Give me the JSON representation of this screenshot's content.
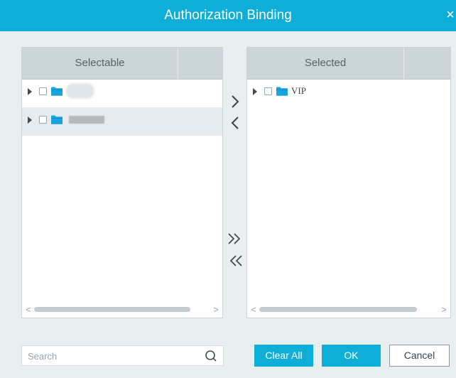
{
  "dialog": {
    "title": "Authorization Binding",
    "close_glyph": "×"
  },
  "selectable": {
    "header": "Selectable",
    "items": [
      {
        "label": "",
        "icon": "folder-icon",
        "expanded": false
      },
      {
        "label": "",
        "icon": "folder-icon",
        "expanded": false
      }
    ],
    "scroll": {
      "left_glyph": "<",
      "right_glyph": ">"
    }
  },
  "selected": {
    "header": "Selected",
    "items": [
      {
        "label": "VIP",
        "icon": "folder-icon",
        "expanded": false
      }
    ],
    "scroll": {
      "left_glyph": "<",
      "right_glyph": ">"
    }
  },
  "transfer": {
    "add_icon": "chevron-right-icon",
    "remove_icon": "chevron-left-icon",
    "add_all_icon": "double-chevron-right-icon",
    "remove_all_icon": "double-chevron-left-icon"
  },
  "search": {
    "placeholder": "Search",
    "value": ""
  },
  "buttons": {
    "clear_all": "Clear All",
    "ok": "OK",
    "cancel": "Cancel"
  },
  "colors": {
    "accent": "#0eaed9",
    "folder": "#1aa3e0",
    "header_bg": "#cbd5da",
    "body_bg": "#e9eef1"
  }
}
